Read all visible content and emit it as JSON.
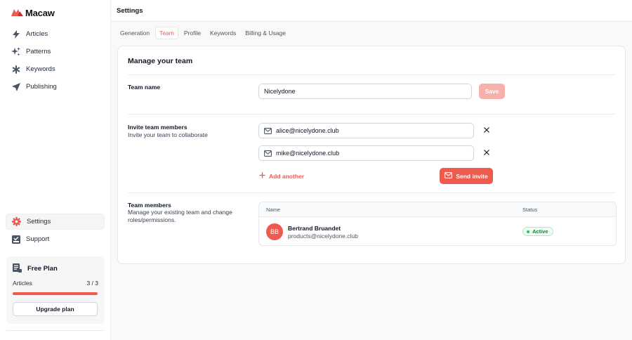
{
  "brand": {
    "name": "Macaw",
    "accent": "#ef5a4f"
  },
  "sidebar": {
    "top_items": [
      {
        "label": "Articles",
        "icon": "lightning-icon"
      },
      {
        "label": "Patterns",
        "icon": "sparkles-icon"
      },
      {
        "label": "Keywords",
        "icon": "asterisk-icon"
      },
      {
        "label": "Publishing",
        "icon": "paper-plane-icon"
      }
    ],
    "bottom_items": [
      {
        "label": "Settings",
        "icon": "gear-icon",
        "active": true
      },
      {
        "label": "Support",
        "icon": "support-icon"
      }
    ],
    "plan": {
      "title": "Free Plan",
      "usage_label": "Articles",
      "usage_value": "3 / 3",
      "usage_fraction": 1.0,
      "upgrade_label": "Upgrade plan"
    }
  },
  "header": {
    "title": "Settings"
  },
  "tabs": [
    {
      "label": "Generation"
    },
    {
      "label": "Team",
      "active": true
    },
    {
      "label": "Profile"
    },
    {
      "label": "Keywords"
    },
    {
      "label": "Billing & Usage"
    }
  ],
  "team": {
    "title": "Manage your team",
    "team_name": {
      "label": "Team name",
      "value": "Nicelydone",
      "save_label": "Save"
    },
    "invite": {
      "title": "Invite team members",
      "subtitle": "Invite your team to collaborate",
      "emails": [
        "alice@nicelydone.club",
        "mike@nicelydone.club"
      ],
      "add_label": "Add another",
      "send_label": "Send invite"
    },
    "members": {
      "title": "Team members",
      "subtitle": "Manage your existing team and change roles/permissions.",
      "columns": {
        "name": "Name",
        "status": "Status"
      },
      "rows": [
        {
          "initials": "BB",
          "name": "Bertrand Bruandet",
          "email": "products@nicelydone.club",
          "status": "Active"
        }
      ]
    }
  }
}
